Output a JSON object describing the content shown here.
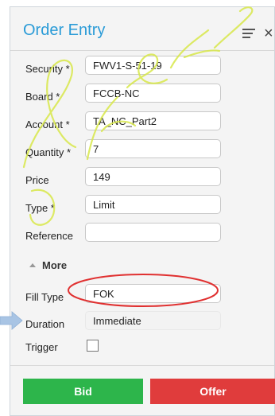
{
  "window": {
    "title": "Order Entry",
    "menu_icon": "hamburger-menu-icon",
    "close_icon": "close-icon",
    "close_glyph": "×"
  },
  "form": {
    "security": {
      "label": "Security *",
      "value": "FWV1-S-51-19"
    },
    "board": {
      "label": "Board *",
      "value": "FCCB-NC"
    },
    "account": {
      "label": "Account *",
      "value": "TA_NC_Part2"
    },
    "quantity": {
      "label": "Quantity *",
      "value": "7"
    },
    "price": {
      "label": "Price",
      "value": "149"
    },
    "type": {
      "label": "Type *",
      "value": "Limit"
    },
    "reference": {
      "label": "Reference",
      "value": ""
    }
  },
  "more": {
    "label": "More",
    "icon": "collapse-up-triangle-icon"
  },
  "advanced": {
    "fill_type": {
      "label": "Fill Type",
      "value": "FOK"
    },
    "duration": {
      "label": "Duration",
      "value": "Immediate"
    },
    "trigger": {
      "label": "Trigger",
      "checked": false
    }
  },
  "actions": {
    "bid_label": "Bid",
    "offer_label": "Offer"
  },
  "annotations": {
    "oval_color": "#e03030",
    "arrow_color": "#a8c4e4"
  },
  "colors": {
    "title": "#2a9bd7",
    "bid": "#2db54b",
    "offer": "#e03c3c",
    "panel": "#f4f4f4"
  }
}
